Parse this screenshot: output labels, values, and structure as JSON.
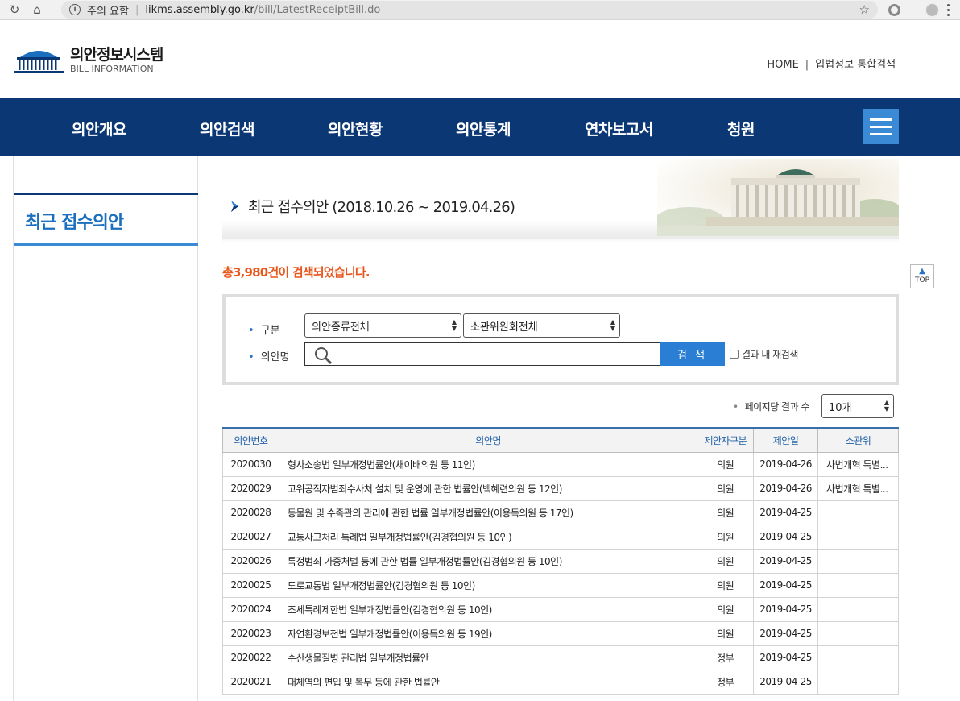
{
  "browser": {
    "warning": "주의 요함",
    "host": "likms.assembly.go.kr",
    "path": "/bill/LatestReceiptBill.do"
  },
  "header": {
    "logo_title": "의안정보시스템",
    "logo_sub": "BILL INFORMATION",
    "util_home": "HOME",
    "util_divider": "|",
    "util_search": "입법정보 통합검색"
  },
  "gnb": {
    "items": [
      "의안개요",
      "의안검색",
      "의안현황",
      "의안통계",
      "연차보고서",
      "청원"
    ]
  },
  "lnb": {
    "title": "최근 접수의안"
  },
  "page": {
    "title": "최근 접수의안 (2018.10.26 ~ 2019.04.26)",
    "result_count": "총3,980건이 검색되었습니다.",
    "top_label": "TOP"
  },
  "search": {
    "label_type": "구분",
    "label_name": "의안명",
    "select_type": "의안종류전체",
    "select_committee": "소관위원회전체",
    "search_button": "검 색",
    "re_search_label": "결과 내 재검색"
  },
  "paging": {
    "label": "페이지당 결과 수",
    "value": "10개"
  },
  "table": {
    "headers": [
      "의안번호",
      "의안명",
      "제안자구분",
      "제안일",
      "소관위"
    ],
    "rows": [
      {
        "no": "2020030",
        "name": "형사소송법 일부개정법률안(채이배의원 등 11인)",
        "proposer": "의원",
        "date": "2019-04-26",
        "committee": "사법개혁 특별..."
      },
      {
        "no": "2020029",
        "name": "고위공직자범죄수사처 설치 및 운영에 관한 법률안(백혜련의원 등 12인)",
        "proposer": "의원",
        "date": "2019-04-26",
        "committee": "사법개혁 특별..."
      },
      {
        "no": "2020028",
        "name": "동물원 및 수족관의 관리에 관한 법률 일부개정법률안(이용득의원 등 17인)",
        "proposer": "의원",
        "date": "2019-04-25",
        "committee": ""
      },
      {
        "no": "2020027",
        "name": "교통사고처리 특례법 일부개정법률안(김경협의원 등 10인)",
        "proposer": "의원",
        "date": "2019-04-25",
        "committee": ""
      },
      {
        "no": "2020026",
        "name": "특정범죄 가중처벌 등에 관한 법률 일부개정법률안(김경협의원 등 10인)",
        "proposer": "의원",
        "date": "2019-04-25",
        "committee": ""
      },
      {
        "no": "2020025",
        "name": "도로교통법 일부개정법률안(김경협의원 등 10인)",
        "proposer": "의원",
        "date": "2019-04-25",
        "committee": ""
      },
      {
        "no": "2020024",
        "name": "조세특례제한법 일부개정법률안(김경협의원 등 10인)",
        "proposer": "의원",
        "date": "2019-04-25",
        "committee": ""
      },
      {
        "no": "2020023",
        "name": "자연환경보전법 일부개정법률안(이용득의원 등 19인)",
        "proposer": "의원",
        "date": "2019-04-25",
        "committee": ""
      },
      {
        "no": "2020022",
        "name": "수산생물질병 관리법 일부개정법률안",
        "proposer": "정부",
        "date": "2019-04-25",
        "committee": ""
      },
      {
        "no": "2020021",
        "name": "대체역의 편입 및 복무 등에 관한 법률안",
        "proposer": "정부",
        "date": "2019-04-25",
        "committee": ""
      }
    ]
  }
}
